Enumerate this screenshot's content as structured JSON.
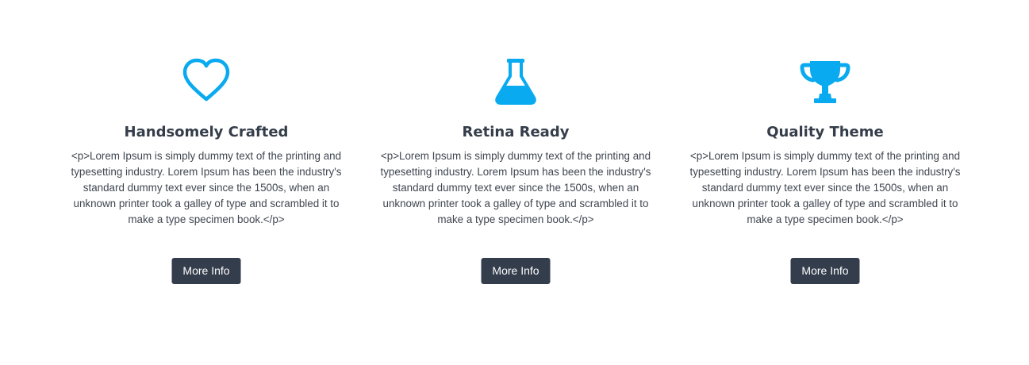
{
  "accent_color": "#0aaaf0",
  "button_color": "#343d4c",
  "features": [
    {
      "icon": "heart-icon",
      "title": "Handsomely Crafted",
      "text": "<p>Lorem Ipsum is simply dummy text of the printing and typesetting industry. Lorem Ipsum has been the industry's standard dummy text ever since the 1500s, when an unknown printer took a galley of type and scrambled it to make a type specimen book.</p>",
      "button_label": "More Info"
    },
    {
      "icon": "flask-icon",
      "title": "Retina Ready",
      "text": "<p>Lorem Ipsum is simply dummy text of the printing and typesetting industry. Lorem Ipsum has been the industry's standard dummy text ever since the 1500s, when an unknown printer took a galley of type and scrambled it to make a type specimen book.</p>",
      "button_label": "More Info"
    },
    {
      "icon": "trophy-icon",
      "title": "Quality Theme",
      "text": "<p>Lorem Ipsum is simply dummy text of the printing and typesetting industry. Lorem Ipsum has been the industry's standard dummy text ever since the 1500s, when an unknown printer took a galley of type and scrambled it to make a type specimen book.</p>",
      "button_label": "More Info"
    }
  ]
}
